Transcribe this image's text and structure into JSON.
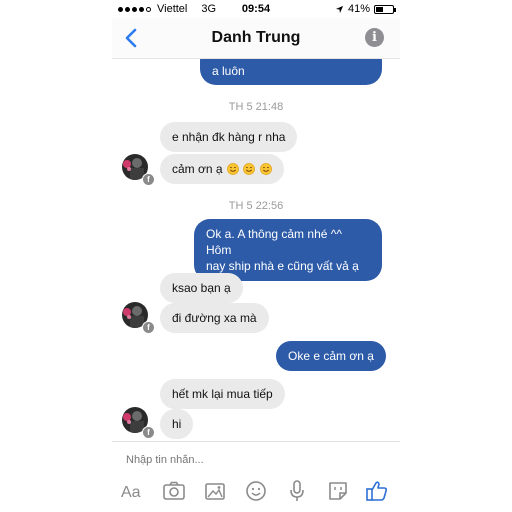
{
  "status": {
    "carrier": "Viettel",
    "network": "3G",
    "time": "09:54",
    "battery": "41%",
    "battery_level": 0.41
  },
  "header": {
    "title": "Danh Trung"
  },
  "messages": {
    "partial_out": "a luôn",
    "stamp1": "TH 5 21:48",
    "in1": "e nhận đk hàng r nha",
    "in2": "cảm ơn ạ",
    "stamp2": "TH 5 22:56",
    "out1_line1": "Ok a. A thông cảm nhé ^^ Hôm",
    "out1_line2": "nay ship nhà e cũng vất vả ạ",
    "in3": "ksao bạn ạ",
    "in4": "đi đường xa mà",
    "out2": "Oke e cảm ơn ạ",
    "in5": "hết mk lại mua tiếp",
    "in6": "hi"
  },
  "composer": {
    "placeholder": "Nhập tin nhắn..."
  },
  "icons": {
    "back": "chevron-left-icon",
    "info": "info-icon",
    "toolbar": [
      "text-format-icon",
      "camera-icon",
      "gallery-icon",
      "emoji-icon",
      "microphone-icon",
      "sticker-icon",
      "like-icon"
    ]
  },
  "colors": {
    "accent": "#2d5ba8",
    "incoming_bubble": "#eaeaea",
    "toolbar_icon": "#8a8a8a",
    "like": "#2d6fd6"
  }
}
